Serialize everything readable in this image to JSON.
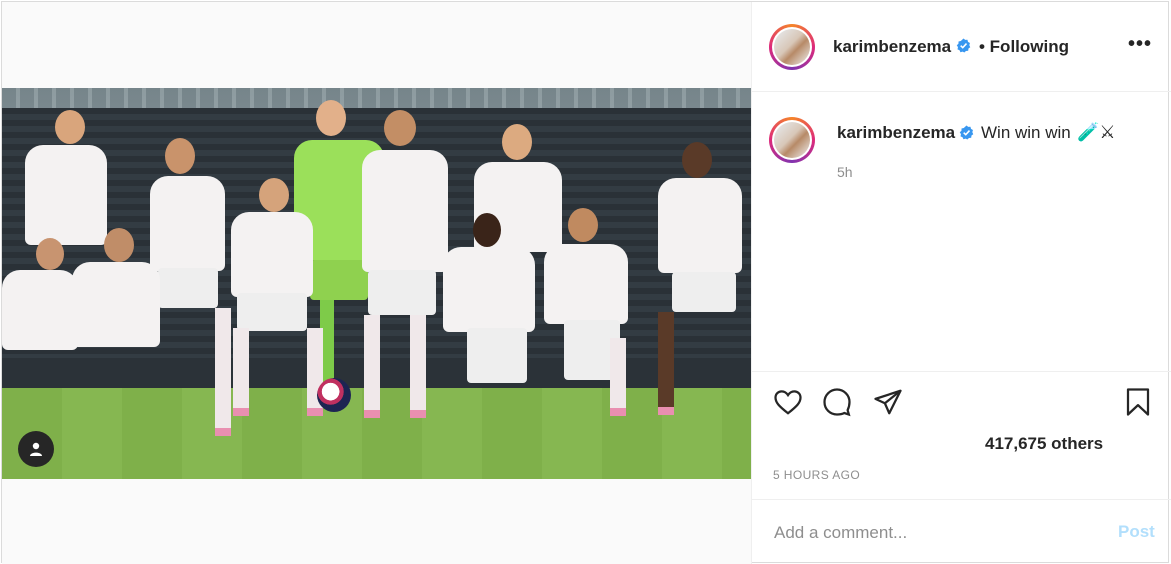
{
  "post": {
    "username": "karimbenzema",
    "follow_status": "• Following",
    "more_icon": "more-horizontal-icon",
    "caption_text": "Win win win",
    "caption_emojis": "🧪⚔",
    "time_ago": "5h",
    "likes_text": "417,675 others",
    "date_text": "5 HOURS AGO",
    "comment_placeholder": "Add a comment...",
    "post_label": "Post"
  },
  "colors": {
    "verified": "#3897f0",
    "post_button_disabled": "#b2dffc",
    "muted_text": "#8e8e8e",
    "border": "#efefef"
  },
  "icons": {
    "like": "heart-icon",
    "comment": "comment-bubble-icon",
    "share": "paper-plane-icon",
    "save": "bookmark-icon",
    "tag": "user-tag-icon"
  }
}
